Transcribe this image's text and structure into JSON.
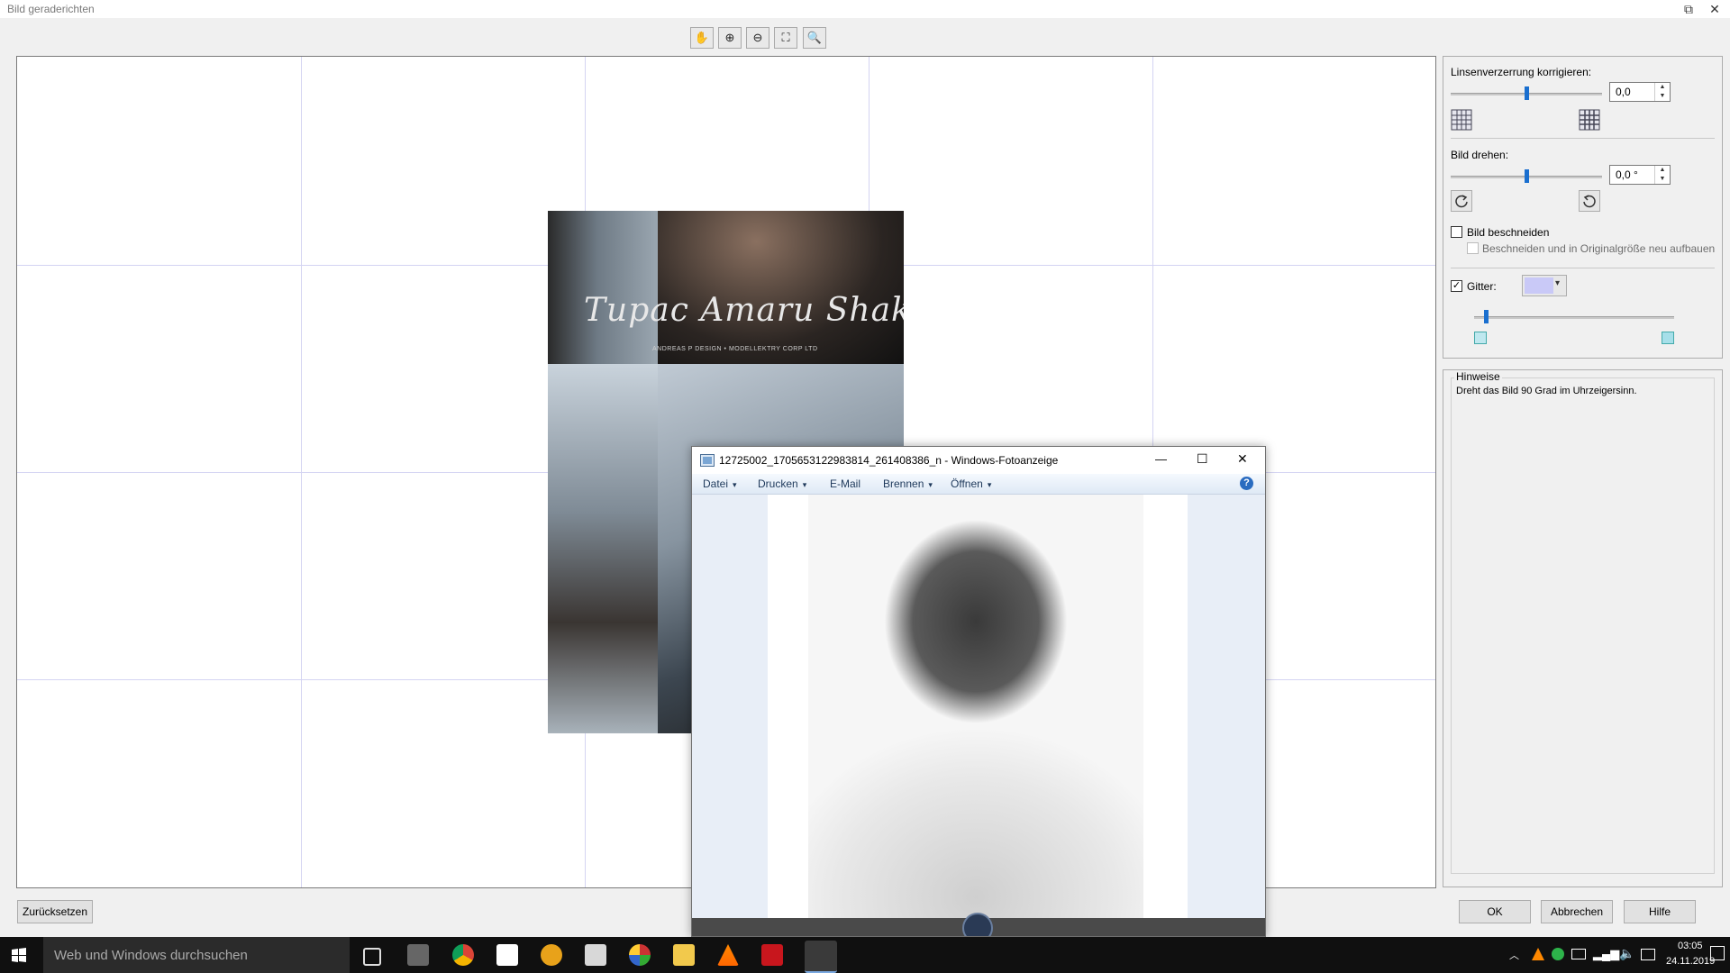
{
  "window": {
    "title": "Bild geraderichten",
    "restore_glyph": "⧉",
    "close_glyph": "✕"
  },
  "toolbar": {
    "tools": [
      {
        "name": "pan-hand-icon",
        "glyph": "✋"
      },
      {
        "name": "zoom-in-icon",
        "glyph": "⊕"
      },
      {
        "name": "zoom-out-icon",
        "glyph": "⊖"
      },
      {
        "name": "fit-to-window-icon",
        "glyph": "⛶"
      },
      {
        "name": "actual-size-icon",
        "glyph": "🔍"
      }
    ]
  },
  "photo": {
    "script_text": "Tupac Amaru Shakur",
    "credit_text": "ANDREAS P DESIGN • MODELLEKTRY CORP LTD"
  },
  "panel": {
    "lens_label": "Linsenverzerrung korrigieren:",
    "lens_value": "0,0",
    "lens_level": 0.5,
    "rotate_label": "Bild drehen:",
    "rotate_value": "0,0 °",
    "rotate_level": 0.5,
    "crop_label": "Bild beschneiden",
    "crop_checked": false,
    "crop_rebuild_label": "Beschneiden und in Originalgröße neu aufbauen",
    "grid_label": "Gitter:",
    "grid_checked": true,
    "grid_color": "#c9c9f7",
    "grid_level": 0.05,
    "hints_title": "Hinweise",
    "hints_text": "Dreht das Bild 90 Grad im Uhrzeigersinn."
  },
  "buttons": {
    "reset": "Zurücksetzen",
    "ok": "OK",
    "cancel": "Abbrechen",
    "help": "Hilfe"
  },
  "viewer": {
    "title": "12725002_1705653122983814_261408386_n - Windows-Fotoanzeige",
    "menus": [
      "Datei",
      "Drucken",
      "E-Mail",
      "Brennen",
      "Öffnen"
    ],
    "menu_has_arrow": [
      true,
      true,
      false,
      true,
      true
    ],
    "minimize_glyph": "—",
    "maximize_glyph": "☐",
    "close_glyph": "✕",
    "help_glyph": "?"
  },
  "taskbar": {
    "search_placeholder": "Web und Windows durchsuchen",
    "time": "03:05",
    "date": "24.11.2019"
  },
  "colors": {
    "accent": "#1a6fcf",
    "grid_line": "#d4d4f2"
  }
}
